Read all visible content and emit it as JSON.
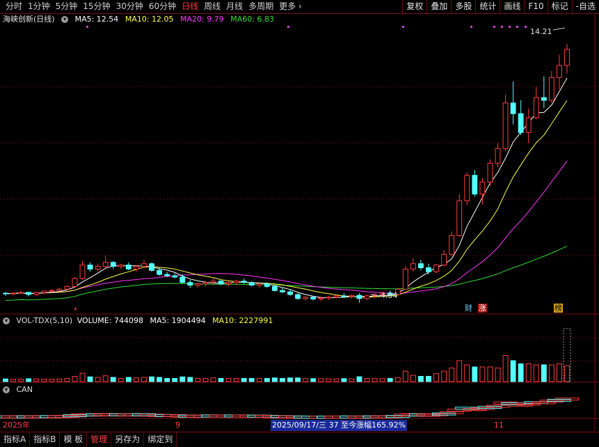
{
  "toolbar": {
    "periods": [
      "分时",
      "1分钟",
      "5分钟",
      "15分钟",
      "30分钟",
      "60分钟",
      "日线",
      "周线",
      "月线",
      "多周期",
      "更多"
    ],
    "active_period": "日线",
    "right_buttons": [
      "复权",
      "叠加",
      "多股",
      "统计",
      "画线",
      "F10",
      "标记",
      "-自选"
    ]
  },
  "main_panel": {
    "stock_title": "海峡创新(日线)",
    "ma5": "MA5: 12.54",
    "ma10": "MA10: 12.05",
    "ma20": "MA20: 9.79",
    "ma60": "MA60: 6.83",
    "high_label": "14.21",
    "low_label": "4.54",
    "tags": [
      "财",
      "涨",
      "榜"
    ]
  },
  "volume_panel": {
    "title": "VOL-TDX(5,10)",
    "volume": "VOLUME: 744098",
    "ma5": "MA5: 1904494",
    "ma10": "MA10: 2227991"
  },
  "can_panel": {
    "title": "CAN"
  },
  "date_axis": {
    "year_label": "2025年",
    "month_9": "9",
    "cursor_info": "2025/09/17/三  37  至今涨幅165.92%",
    "month_11": "11"
  },
  "bottom_tabs": [
    "指标A",
    "指标B",
    "模 板",
    "管理",
    "另存为",
    "绑定到"
  ],
  "active_tab": "管理",
  "colors": {
    "up": "#ff3c3c",
    "down": "#54ffff",
    "ma5": "#ffffff",
    "ma10": "#ffff44",
    "ma20": "#ff33ff",
    "ma60": "#33dd33"
  },
  "chart_data": {
    "type": "candlestick",
    "title": "海峡创新(日线)",
    "y_range": [
      4.54,
      14.21
    ],
    "candles_ohlc": [
      [
        4.9,
        4.95,
        4.8,
        4.88
      ],
      [
        4.88,
        4.95,
        4.82,
        4.9
      ],
      [
        4.9,
        4.98,
        4.85,
        4.93
      ],
      [
        4.93,
        4.95,
        4.78,
        4.85
      ],
      [
        4.85,
        4.95,
        4.8,
        4.92
      ],
      [
        4.92,
        5.0,
        4.88,
        4.98
      ],
      [
        4.98,
        5.05,
        4.92,
        5.0
      ],
      [
        5.0,
        5.1,
        4.95,
        5.05
      ],
      [
        5.05,
        5.2,
        5.0,
        5.15
      ],
      [
        5.15,
        5.5,
        5.1,
        5.45
      ],
      [
        5.45,
        6.1,
        5.4,
        5.95
      ],
      [
        5.95,
        6.05,
        5.7,
        5.8
      ],
      [
        5.8,
        6.0,
        5.7,
        5.9
      ],
      [
        5.9,
        6.3,
        5.85,
        6.05
      ],
      [
        6.05,
        6.1,
        5.8,
        5.9
      ],
      [
        5.9,
        6.0,
        5.8,
        5.95
      ],
      [
        5.95,
        6.05,
        5.75,
        5.8
      ],
      [
        5.8,
        5.95,
        5.7,
        5.9
      ],
      [
        5.9,
        6.15,
        5.85,
        6.0
      ],
      [
        6.0,
        6.05,
        5.7,
        5.75
      ],
      [
        5.75,
        5.85,
        5.55,
        5.6
      ],
      [
        5.6,
        5.7,
        5.5,
        5.55
      ],
      [
        5.55,
        5.65,
        5.45,
        5.5
      ],
      [
        5.5,
        5.6,
        5.25,
        5.3
      ],
      [
        5.3,
        5.4,
        5.1,
        5.2
      ],
      [
        5.2,
        5.3,
        5.1,
        5.25
      ],
      [
        5.25,
        5.35,
        5.15,
        5.3
      ],
      [
        5.3,
        5.45,
        5.2,
        5.35
      ],
      [
        5.35,
        5.4,
        5.2,
        5.25
      ],
      [
        5.25,
        5.35,
        5.15,
        5.3
      ],
      [
        5.3,
        5.4,
        5.2,
        5.35
      ],
      [
        5.35,
        5.45,
        5.25,
        5.3
      ],
      [
        5.3,
        5.35,
        5.15,
        5.2
      ],
      [
        5.2,
        5.3,
        5.1,
        5.25
      ],
      [
        5.25,
        5.3,
        5.1,
        5.15
      ],
      [
        5.15,
        5.2,
        4.95,
        5.0
      ],
      [
        5.0,
        5.1,
        4.9,
        4.95
      ],
      [
        4.95,
        5.05,
        4.8,
        4.85
      ],
      [
        4.85,
        4.9,
        4.65,
        4.7
      ],
      [
        4.7,
        4.8,
        4.62,
        4.75
      ],
      [
        4.75,
        4.8,
        4.62,
        4.68
      ],
      [
        4.68,
        4.78,
        4.6,
        4.72
      ],
      [
        4.72,
        4.8,
        4.65,
        4.75
      ],
      [
        4.75,
        4.85,
        4.7,
        4.8
      ],
      [
        4.8,
        4.9,
        4.72,
        4.78
      ],
      [
        4.78,
        4.85,
        4.7,
        4.82
      ],
      [
        4.82,
        4.9,
        4.54,
        4.7
      ],
      [
        4.7,
        4.85,
        4.65,
        4.8
      ],
      [
        4.8,
        4.9,
        4.72,
        4.85
      ],
      [
        4.85,
        4.95,
        4.78,
        4.9
      ],
      [
        4.9,
        5.0,
        4.8,
        4.85
      ],
      [
        4.85,
        5.1,
        4.82,
        5.05
      ],
      [
        5.05,
        5.9,
        5.0,
        5.8
      ],
      [
        5.8,
        6.2,
        5.7,
        6.0
      ],
      [
        6.0,
        6.15,
        5.75,
        5.85
      ],
      [
        5.85,
        6.0,
        5.6,
        5.7
      ],
      [
        5.7,
        6.0,
        5.65,
        5.95
      ],
      [
        5.95,
        6.5,
        5.9,
        6.35
      ],
      [
        6.35,
        7.2,
        6.3,
        7.05
      ],
      [
        7.05,
        8.6,
        7.0,
        8.35
      ],
      [
        8.35,
        9.4,
        8.2,
        9.3
      ],
      [
        9.3,
        9.5,
        8.5,
        8.6
      ],
      [
        8.6,
        9.2,
        8.2,
        9.05
      ],
      [
        9.05,
        9.9,
        8.9,
        9.75
      ],
      [
        9.75,
        10.5,
        9.6,
        10.3
      ],
      [
        10.3,
        12.3,
        10.2,
        12.0
      ],
      [
        12.0,
        12.8,
        11.2,
        11.6
      ],
      [
        11.6,
        12.1,
        10.8,
        10.9
      ],
      [
        10.9,
        11.8,
        10.5,
        11.45
      ],
      [
        11.45,
        12.6,
        11.4,
        12.2
      ],
      [
        12.2,
        13.0,
        11.8,
        12.1
      ],
      [
        12.1,
        13.2,
        12.0,
        12.95
      ],
      [
        12.95,
        13.8,
        12.5,
        13.4
      ],
      [
        13.4,
        14.21,
        13.1,
        14.0
      ]
    ],
    "volume_max_label": "",
    "series_labels": [
      "MA5",
      "MA10",
      "MA20",
      "MA60"
    ]
  }
}
